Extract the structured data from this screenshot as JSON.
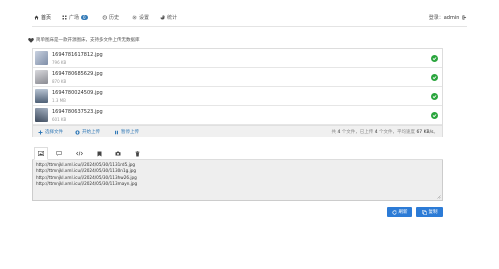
{
  "nav": {
    "items": [
      {
        "label": "首页",
        "icon": "home-icon"
      },
      {
        "label": "广场",
        "icon": "grid-icon",
        "badge": "0"
      },
      {
        "label": "历史",
        "icon": "history-icon"
      },
      {
        "label": "设置",
        "icon": "gear-icon"
      },
      {
        "label": "统计",
        "icon": "chart-icon"
      }
    ],
    "login_prefix": "登录：",
    "username": "admin",
    "logout_icon": "logout-icon"
  },
  "notice": {
    "icon": "heart-icon",
    "text": "简单图床是一款开源图床，支持多文件上传无数据库"
  },
  "files": [
    {
      "name": "1694781617812.jpg",
      "size": "796 KB",
      "thumb_color": "#8b9bb5",
      "status": "success"
    },
    {
      "name": "1694780685629.jpg",
      "size": "870 KB",
      "thumb_color": "#a9aab0",
      "status": "success"
    },
    {
      "name": "1694780024509.jpg",
      "size": "1.3 MB",
      "thumb_color": "#6f8196",
      "status": "success"
    },
    {
      "name": "1694780637523.jpg",
      "size": "601 KB",
      "thumb_color": "#5a6a80",
      "status": "success"
    }
  ],
  "toolbar": {
    "select_label": "选择文件",
    "start_label": "开始上传",
    "pause_label": "暂停上传",
    "stats": {
      "p1": "共",
      "total": "4",
      "p2": "个文件，已上传",
      "uploaded": "4",
      "p3": "个文件，平均速度",
      "speed": "67 KB/s",
      "p4": "。"
    }
  },
  "tabs": [
    {
      "icon": "image-icon",
      "active": true
    },
    {
      "icon": "comment-icon",
      "active": false
    },
    {
      "icon": "code-icon",
      "active": false
    },
    {
      "icon": "markdown-icon",
      "active": false
    },
    {
      "icon": "camera-icon",
      "active": false
    },
    {
      "icon": "trash-icon",
      "active": false
    }
  ],
  "links": [
    "http://ttmnjkl.xml.icu/i/2024/05/30/1131rd5.jpg",
    "http://ttmnjkl.xml.icu/i/2024/05/30/1130n1g.jpg",
    "http://ttmnjkl.xml.icu/i/2024/05/30/113hw26.jpg",
    "http://ttmnjkl.xml.icu/i/2024/05/30/113mayn.jpg"
  ],
  "buttons": {
    "refresh_label": "刷新",
    "copy_label": "复制"
  },
  "colors": {
    "primary": "#2c7bd6",
    "link": "#337ab7",
    "success": "#2aa53d"
  }
}
